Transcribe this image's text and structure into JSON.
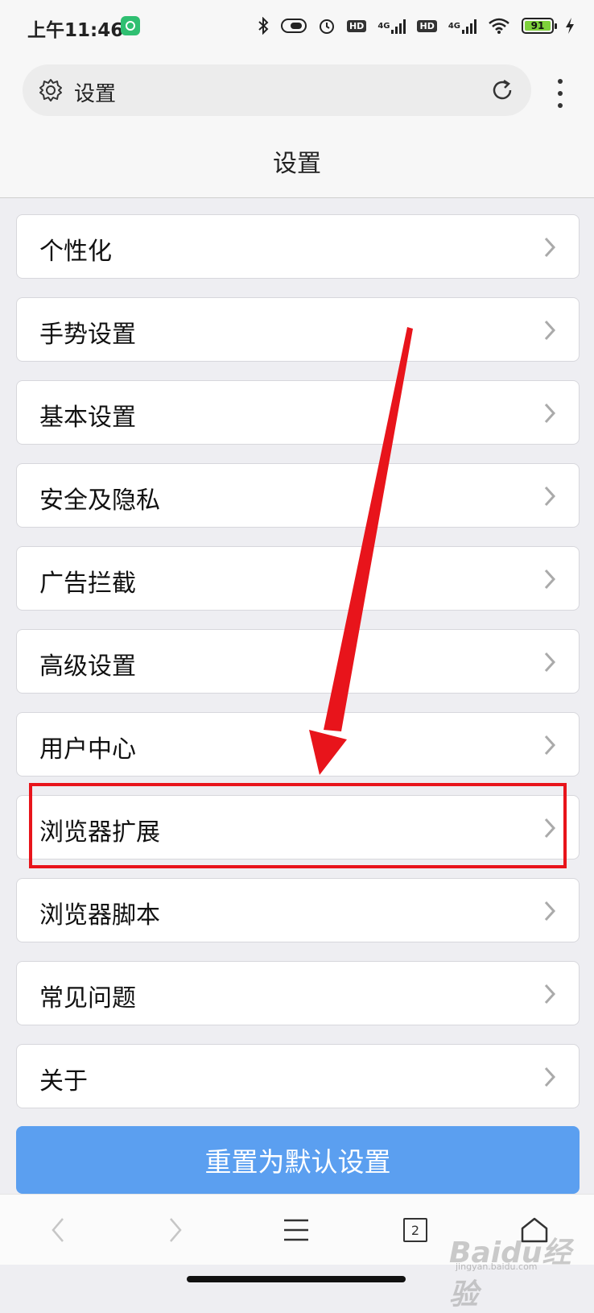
{
  "status_bar": {
    "time": "上午11:46",
    "hd1": "HD",
    "net1": "4G",
    "hd2": "HD",
    "net2": "4G",
    "battery": "91"
  },
  "address_bar": {
    "text": "设置"
  },
  "header": {
    "title": "设置"
  },
  "settings": {
    "items": [
      {
        "label": "个性化"
      },
      {
        "label": "手势设置"
      },
      {
        "label": "基本设置"
      },
      {
        "label": "安全及隐私"
      },
      {
        "label": "广告拦截"
      },
      {
        "label": "高级设置"
      },
      {
        "label": "用户中心"
      },
      {
        "label": "浏览器扩展"
      },
      {
        "label": "浏览器脚本"
      },
      {
        "label": "常见问题"
      },
      {
        "label": "关于"
      }
    ],
    "reset_label": "重置为默认设置"
  },
  "bottom_nav": {
    "tabs_count": "2"
  },
  "annotation": {
    "highlighted_item": "浏览器扩展",
    "color": "#e8141b"
  },
  "watermark": {
    "brand": "Baidu经验",
    "url": "jingyan.baidu.com"
  },
  "icons": [
    "gear-icon",
    "reload-icon",
    "more-icon",
    "chevron-right-icon",
    "back-icon",
    "forward-icon",
    "menu-icon",
    "tabs-icon",
    "home-icon"
  ]
}
